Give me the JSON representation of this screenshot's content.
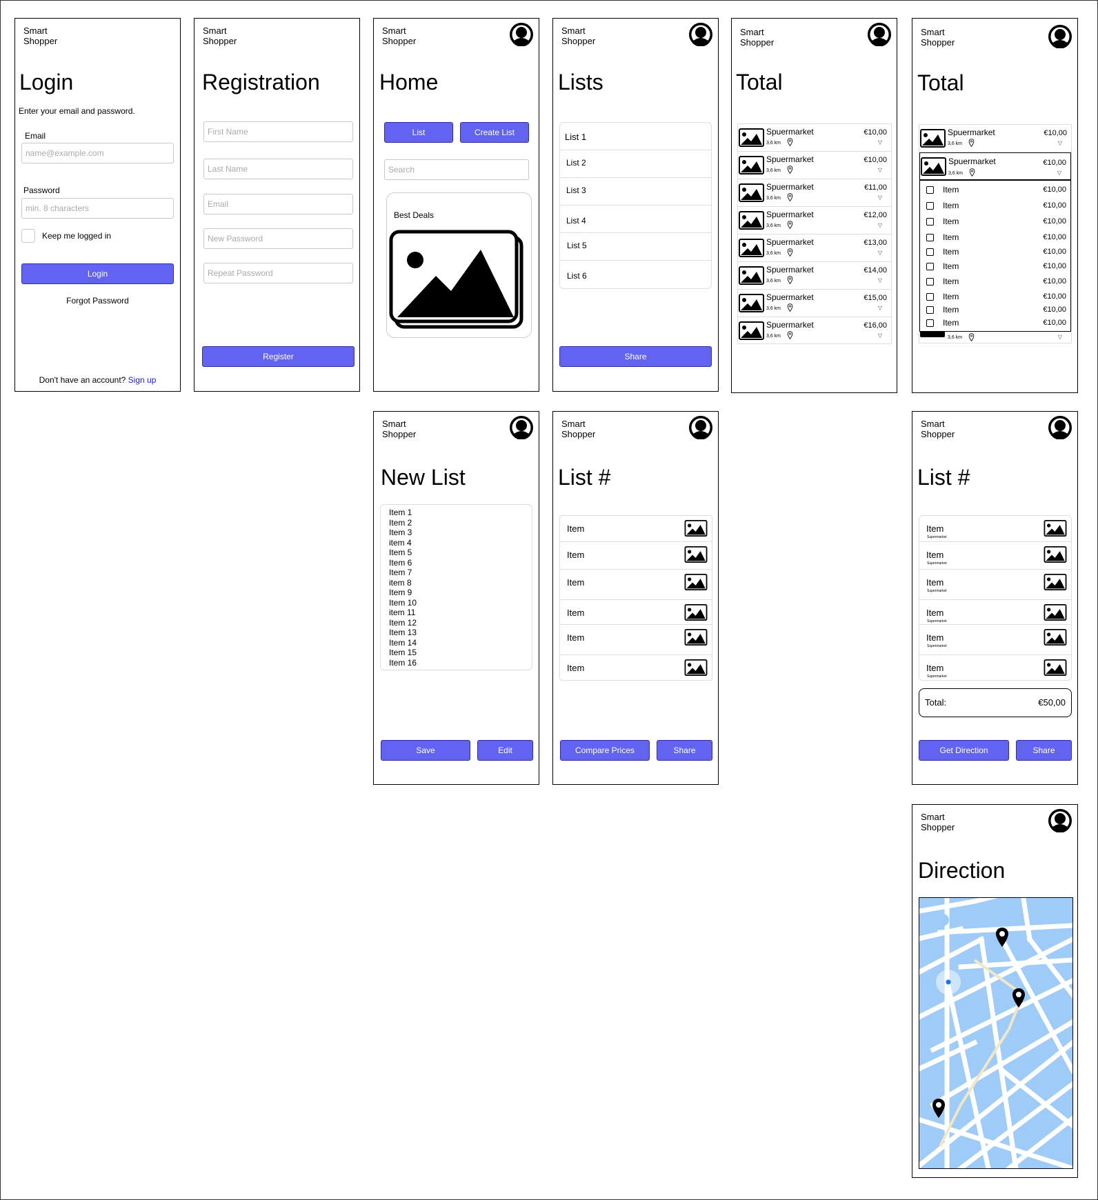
{
  "brand": "Smart\nShopper",
  "login": {
    "title": "Login",
    "subtitle": "Enter your email and password.",
    "email_label": "Email",
    "email_placeholder": "name@example.com",
    "password_label": "Password",
    "password_placeholder": "min. 8 characters",
    "keep_logged": "Keep me logged in",
    "login_button": "Login",
    "forgot": "Forgot Password",
    "no_account": "Don't have an account?",
    "signup": "Sign up"
  },
  "registration": {
    "title": "Registration",
    "fields": [
      "First Name",
      "Last Name",
      "Email",
      "New Password",
      "Repeat Password"
    ],
    "register_button": "Register"
  },
  "home": {
    "title": "Home",
    "list_button": "List",
    "create_button": "Create List",
    "search_placeholder": "Search",
    "best_deals": "Best Deals"
  },
  "lists": {
    "title": "Lists",
    "items": [
      "List 1",
      "List 2",
      "List 3",
      "List 4",
      "List 5",
      "List 6"
    ],
    "share_button": "Share"
  },
  "total": {
    "title": "Total",
    "stores": [
      {
        "name": "Spuermarket",
        "dist": "3,6 km",
        "price": "€10,00"
      },
      {
        "name": "Spuermarket",
        "dist": "3,6 km",
        "price": "€10,00"
      },
      {
        "name": "Spuermarket",
        "dist": "3,6 km",
        "price": "€11,00"
      },
      {
        "name": "Spuermarket",
        "dist": "3,6 km",
        "price": "€12,00"
      },
      {
        "name": "Spuermarket",
        "dist": "3,6 km",
        "price": "€13,00"
      },
      {
        "name": "Spuermarket",
        "dist": "3,6 km",
        "price": "€14,00"
      },
      {
        "name": "Spuermarket",
        "dist": "3,6 km",
        "price": "€15,00"
      },
      {
        "name": "Spuermarket",
        "dist": "3,6 km",
        "price": "€16,00"
      }
    ]
  },
  "total_expanded": {
    "title": "Total",
    "stores": [
      {
        "name": "Spuermarket",
        "dist": "3,6 km",
        "price": "€10,00"
      },
      {
        "name": "Spuermarket",
        "dist": "3,6 km",
        "price": "€10,00"
      }
    ],
    "items": [
      {
        "label": "Item",
        "price": "€10,00"
      },
      {
        "label": "Item",
        "price": "€10,00"
      },
      {
        "label": "Item",
        "price": "€10,00"
      },
      {
        "label": "Item",
        "price": "€10,00"
      },
      {
        "label": "Item",
        "price": "€10,00"
      },
      {
        "label": "Item",
        "price": "€10,00"
      },
      {
        "label": "Item",
        "price": "€10,00"
      },
      {
        "label": "Item",
        "price": "€10,00"
      },
      {
        "label": "Item",
        "price": "€10,00"
      },
      {
        "label": "Item",
        "price": "€10,00"
      }
    ],
    "bottom_dist": "3,6 km"
  },
  "new_list": {
    "title": "New List",
    "items": [
      "Item 1",
      "Item 2",
      "Item 3",
      "item 4",
      "Item 5",
      "Item 6",
      "Item 7",
      "item 8",
      "Item 9",
      "Item 10",
      "item 11",
      "Item 12",
      "Item 13",
      "Item 14",
      "Item 15",
      "Item 16"
    ],
    "save_button": "Save",
    "edit_button": "Edit"
  },
  "list_detail": {
    "title": "List #",
    "items": [
      "Item",
      "Item",
      "Item",
      "Item",
      "Item",
      "Item"
    ],
    "compare_button": "Compare Prices",
    "share_button": "Share"
  },
  "list_total": {
    "title": "List #",
    "items": [
      {
        "label": "Item",
        "store": "Supermarket"
      },
      {
        "label": "Item",
        "store": "Supermarket"
      },
      {
        "label": "Item",
        "store": "Supermarket"
      },
      {
        "label": "Item",
        "store": "Supermarket"
      },
      {
        "label": "Item",
        "store": "Supermarket"
      },
      {
        "label": "Item",
        "store": "Supermarket"
      }
    ],
    "total_label": "Total:",
    "total_value": "€50,00",
    "direction_button": "Get Direction",
    "share_button": "Share"
  },
  "direction": {
    "title": "Direction"
  },
  "colors": {
    "accent": "#6363f1",
    "link": "#2020d0",
    "map_water": "#9ecbf7"
  }
}
